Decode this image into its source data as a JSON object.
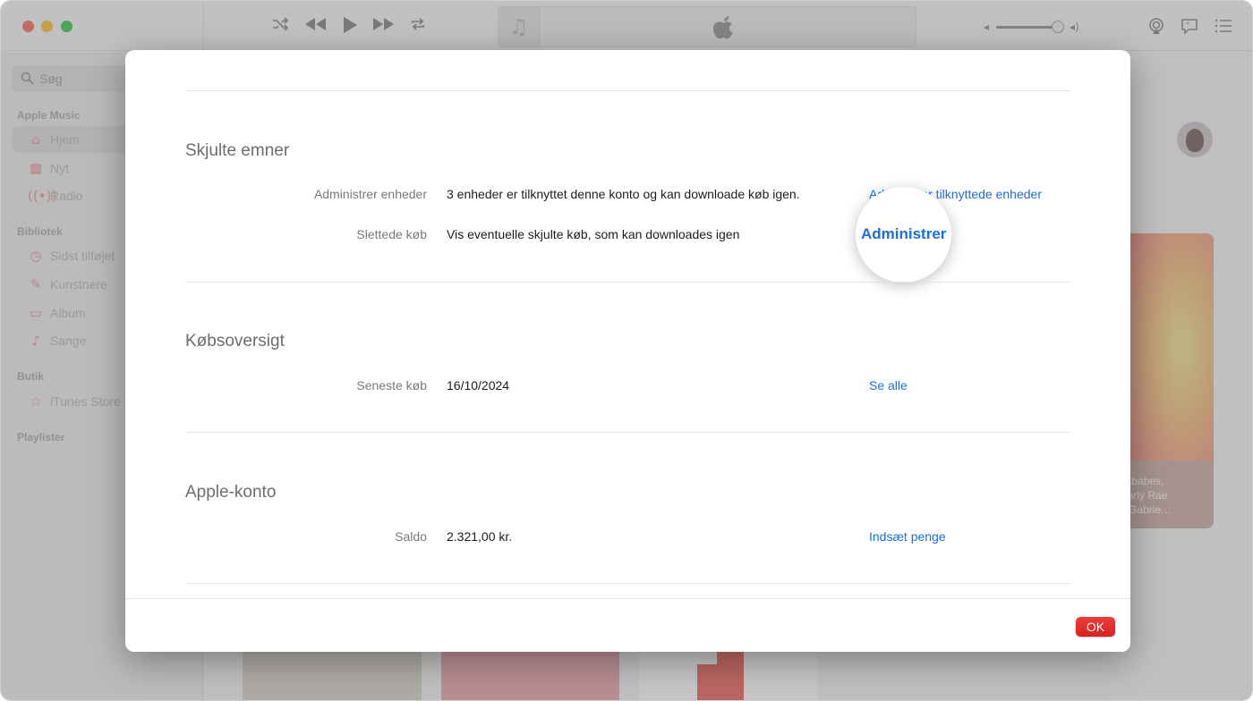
{
  "sidebar": {
    "search_placeholder": "Søg",
    "sections": {
      "apple_music": "Apple Music",
      "library": "Bibliotek",
      "store": "Butik",
      "playlists": "Playlister"
    },
    "items": {
      "home": "Hjem",
      "new": "Nyt",
      "radio": "Radio",
      "recently_added": "Sidst tilføjet",
      "artists": "Kunstnere",
      "albums": "Album",
      "songs": "Sange",
      "itunes_store": "iTunes Store"
    }
  },
  "background_card": {
    "line1": "gababes,",
    "line2": "Carly Rae",
    "line3": "n Gabrie…"
  },
  "dialog": {
    "hidden_items": {
      "title": "Skjulte emner",
      "manage_devices": {
        "label": "Administrer enheder",
        "value": "3 enheder er tilknyttet denne konto og kan downloade køb igen.",
        "link": "Administrer tilknyttede enheder"
      },
      "deleted_purchases": {
        "label": "Slettede køb",
        "value": "Vis eventuelle skjulte køb, som kan downloades igen",
        "link": "Administrer"
      }
    },
    "purchase_history": {
      "title": "Købsoversigt",
      "latest_purchase": {
        "label": "Seneste køb",
        "value": "16/10/2024",
        "link": "Se alle"
      }
    },
    "apple_account": {
      "title": "Apple-konto",
      "balance": {
        "label": "Saldo",
        "value": "2.321,00 kr.",
        "link": "Indsæt penge"
      }
    },
    "ok_label": "OK"
  },
  "colors": {
    "link": "#1b6fe0",
    "ok_button": "#e62c2c",
    "accent_pink": "#f08a95"
  },
  "icons": {
    "toolbar": [
      "shuffle-icon",
      "rewind-icon",
      "play-icon",
      "fast-forward-icon",
      "repeat-icon",
      "music-note-icon",
      "apple-logo-icon",
      "volume-low-icon",
      "volume-high-icon",
      "airplay-icon",
      "lyrics-icon",
      "queue-list-icon"
    ]
  }
}
